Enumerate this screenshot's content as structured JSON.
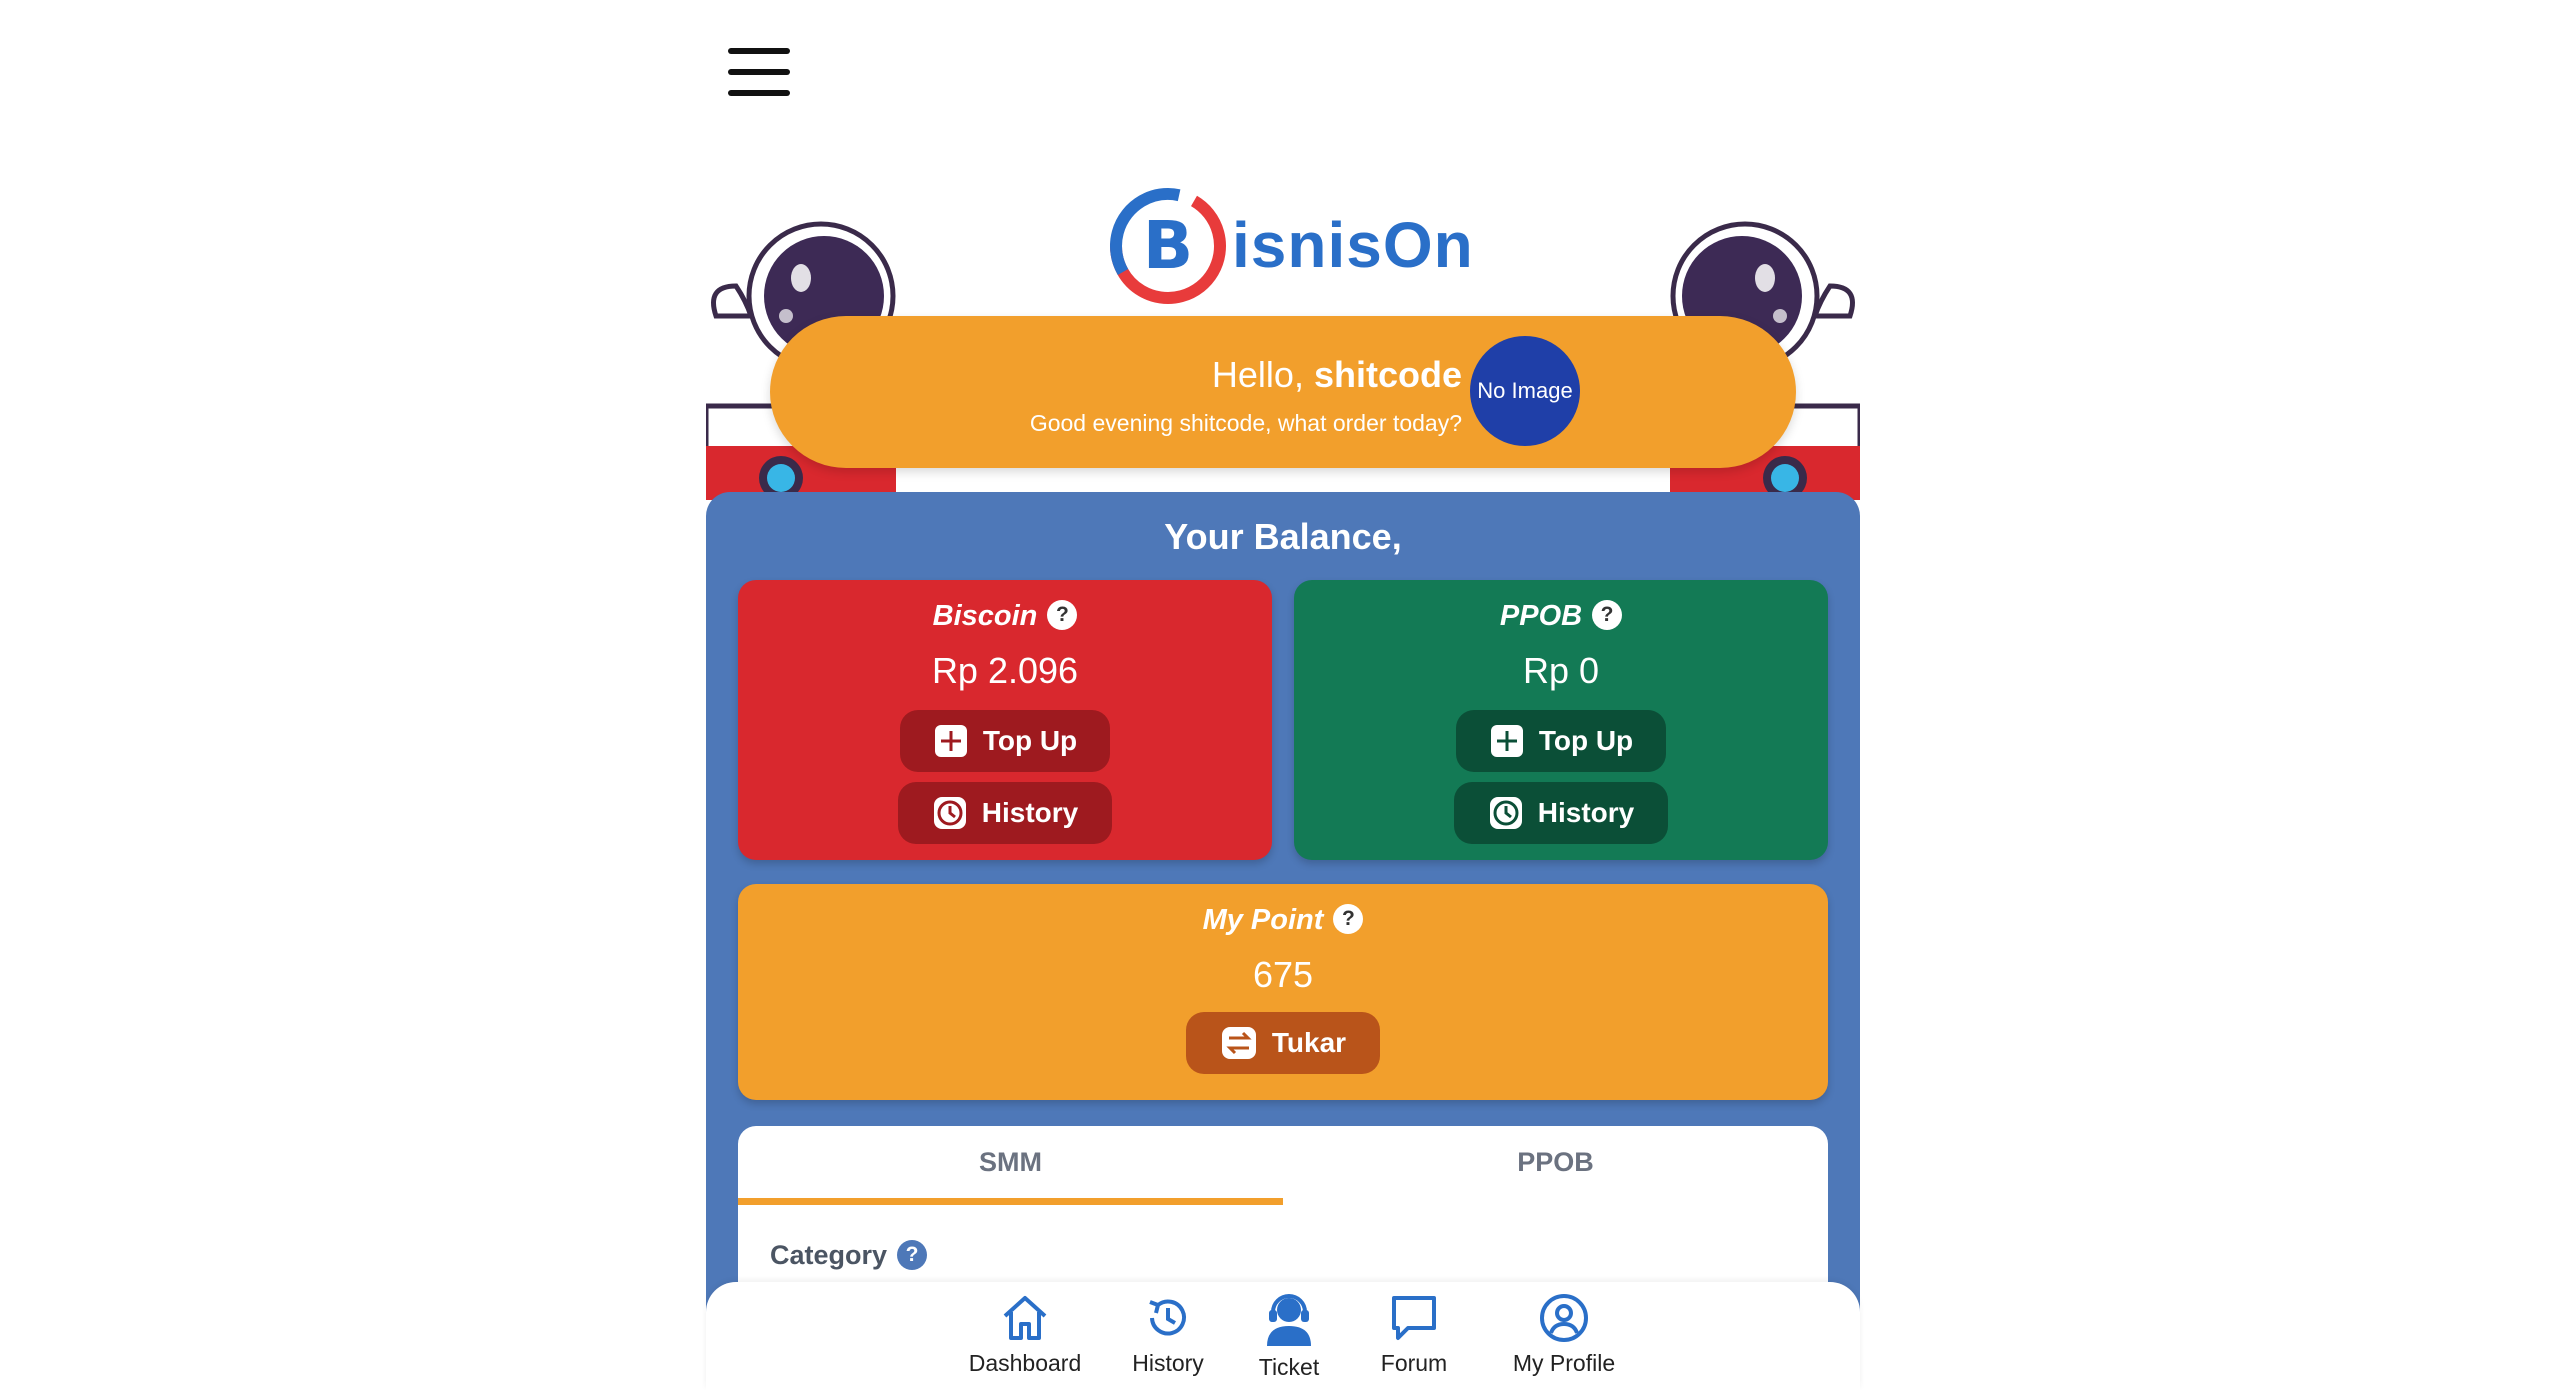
{
  "brand": {
    "logo_text": "isnisOn"
  },
  "greeting": {
    "hello": "Hello,",
    "username": "shitcode",
    "subtitle": "Good evening shitcode, what order today?",
    "avatar_text": "No Image"
  },
  "balance": {
    "title": "Your Balance,",
    "biscoin": {
      "label": "Biscoin",
      "value": "Rp 2.096",
      "topup_label": "Top Up",
      "history_label": "History",
      "color": "#d9282e"
    },
    "ppob": {
      "label": "PPOB",
      "value": "Rp 0",
      "topup_label": "Top Up",
      "history_label": "History",
      "color": "#137a55"
    },
    "point": {
      "label": "My Point",
      "value": "675",
      "exchange_label": "Tukar",
      "color": "#f29f2c"
    },
    "help_symbol": "?"
  },
  "tabs": {
    "items": [
      "SMM",
      "PPOB"
    ],
    "active": "SMM",
    "category_label": "Category"
  },
  "bottom_nav": {
    "items": [
      {
        "label": "Dashboard",
        "icon": "home-icon"
      },
      {
        "label": "History",
        "icon": "history-icon"
      },
      {
        "label": "Ticket",
        "icon": "support-agent-icon"
      },
      {
        "label": "Forum",
        "icon": "chat-icon"
      },
      {
        "label": "My Profile",
        "icon": "user-circle-icon"
      }
    ]
  },
  "colors": {
    "accent_orange": "#f29f2c",
    "panel_blue": "#4e78b8",
    "nav_blue": "#2a6fc8"
  }
}
